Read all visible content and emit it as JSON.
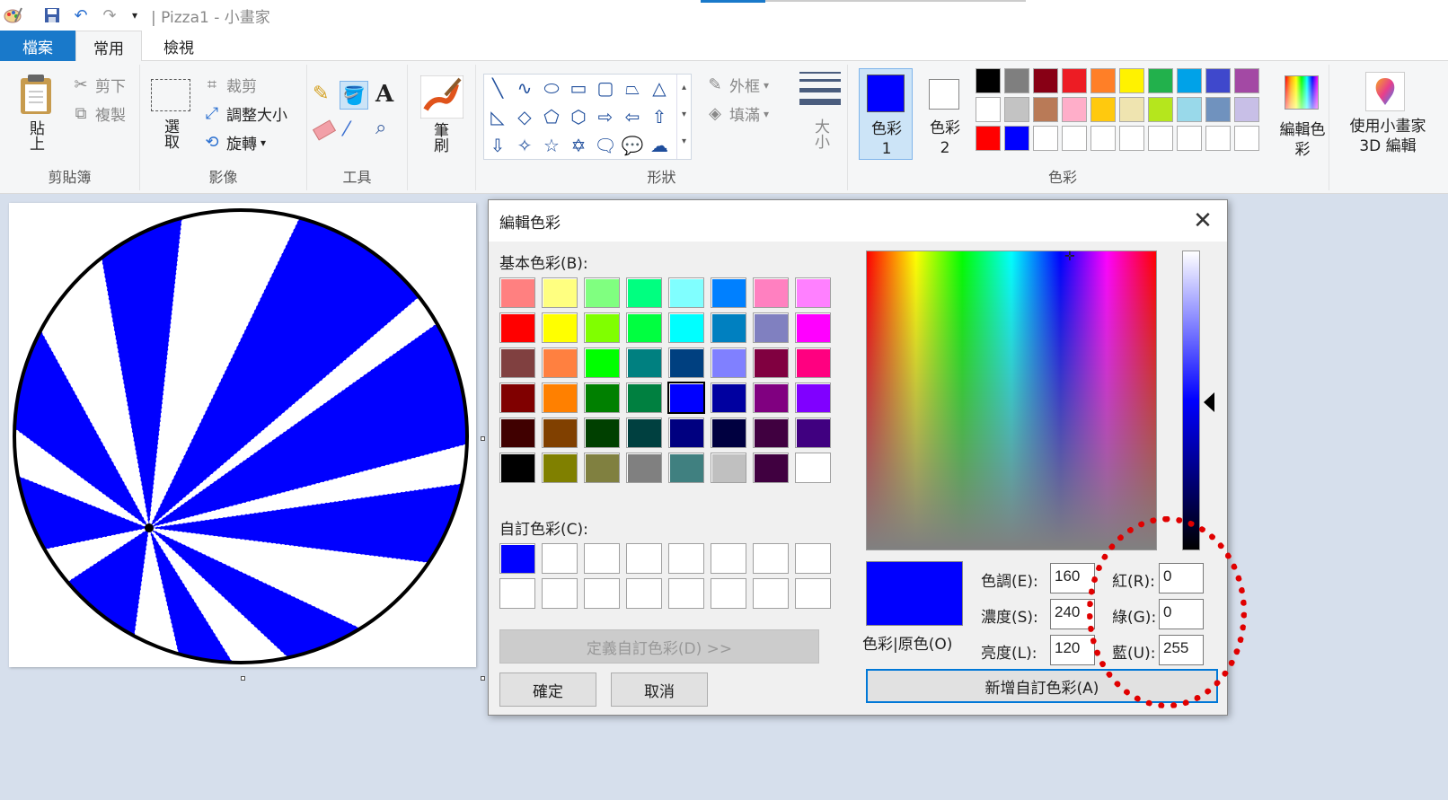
{
  "titlebar": {
    "title": "| Pizza1 - 小畫家",
    "icons": [
      "paint-app-icon",
      "save-icon",
      "undo-icon",
      "redo-icon",
      "customize-dropdown-icon"
    ]
  },
  "tabs": {
    "file": "檔案",
    "home": "常用",
    "view": "檢視"
  },
  "ribbon": {
    "clipboard": {
      "paste": "貼上",
      "cut": "剪下",
      "copy": "複製",
      "label": "剪貼簿"
    },
    "image": {
      "select": "選取",
      "crop": "裁剪",
      "resize": "調整大小",
      "rotate": "旋轉",
      "label": "影像"
    },
    "tools": {
      "label": "工具"
    },
    "brushes": {
      "label": "筆刷"
    },
    "shapes": {
      "outline": "外框",
      "fill": "填滿",
      "label": "形狀"
    },
    "size": {
      "label": "大小"
    },
    "colors": {
      "color1": "色彩 1",
      "color2": "色彩 2",
      "edit": "編輯色彩",
      "label": "色彩",
      "palette_row1": [
        "#000000",
        "#7f7f7f",
        "#880015",
        "#ed1c24",
        "#ff7f27",
        "#fff200",
        "#22b14c",
        "#00a2e8",
        "#3f48cc",
        "#a349a4"
      ],
      "palette_row2": [
        "#ffffff",
        "#c3c3c3",
        "#b97a57",
        "#ffaec9",
        "#ffc90e",
        "#efe4b0",
        "#b5e61d",
        "#99d9ea",
        "#7092be",
        "#c8bfe7"
      ],
      "palette_row3": [
        "#ff0000",
        "#0000ff",
        "#ffffff",
        "#ffffff",
        "#ffffff",
        "#ffffff",
        "#ffffff",
        "#ffffff",
        "#ffffff",
        "#ffffff"
      ],
      "color1_value": "#0000ff",
      "color2_value": "#ffffff"
    },
    "paint3d": {
      "label": "使用小畫家 3D 編輯"
    }
  },
  "dialog": {
    "title": "編輯色彩",
    "basic_label": "基本色彩(B):",
    "custom_label": "自訂色彩(C):",
    "define_button": "定義自訂色彩(D) >>",
    "ok_button": "確定",
    "cancel_button": "取消",
    "preview_label": "色彩|原色(O)",
    "add_button": "新增自訂色彩(A)",
    "hue_label": "色調(E):",
    "sat_label": "濃度(S):",
    "lum_label": "亮度(L):",
    "red_label": "紅(R):",
    "green_label": "綠(G):",
    "blue_label": "藍(U):",
    "hue": "160",
    "sat": "240",
    "lum": "120",
    "red": "0",
    "green": "0",
    "blue": "255",
    "basic_colors": [
      [
        "#ff8080",
        "#ffff80",
        "#80ff80",
        "#00ff80",
        "#80ffff",
        "#0080ff",
        "#ff80c0",
        "#ff80ff"
      ],
      [
        "#ff0000",
        "#ffff00",
        "#80ff00",
        "#00ff40",
        "#00ffff",
        "#0080c0",
        "#8080c0",
        "#ff00ff"
      ],
      [
        "#804040",
        "#ff8040",
        "#00ff00",
        "#008080",
        "#004080",
        "#8080ff",
        "#800040",
        "#ff0080"
      ],
      [
        "#800000",
        "#ff8000",
        "#008000",
        "#008040",
        "#0000ff",
        "#0000a0",
        "#800080",
        "#8000ff"
      ],
      [
        "#400000",
        "#804000",
        "#004000",
        "#004040",
        "#000080",
        "#000040",
        "#400040",
        "#400080"
      ],
      [
        "#000000",
        "#808000",
        "#808040",
        "#808080",
        "#408080",
        "#c0c0c0",
        "#400040",
        "#ffffff"
      ]
    ],
    "custom_colors": [
      [
        "#0000ff",
        "#ffffff",
        "#ffffff",
        "#ffffff",
        "#ffffff",
        "#ffffff",
        "#ffffff",
        "#ffffff"
      ],
      [
        "#ffffff",
        "#ffffff",
        "#ffffff",
        "#ffffff",
        "#ffffff",
        "#ffffff",
        "#ffffff",
        "#ffffff"
      ]
    ],
    "preview_color": "#0000ff"
  },
  "canvas": {
    "slice_color": "#0000ff",
    "background": "#ffffff"
  }
}
